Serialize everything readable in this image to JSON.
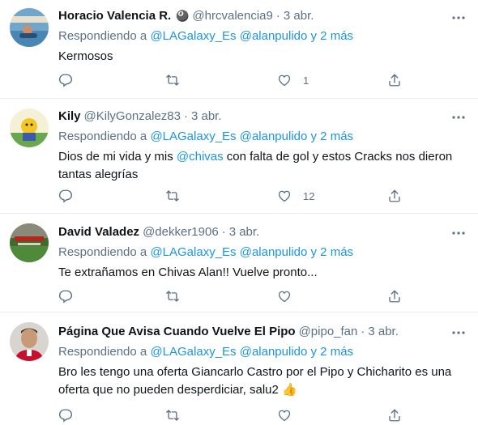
{
  "reply_prefix": "Respondiendo a",
  "tweets": [
    {
      "name": "Horacio Valencia R.",
      "badge": "🎱",
      "handle": "@hrcvalencia9",
      "dot": "·",
      "date": "3 abr.",
      "mention1": "@LAGalaxy_Es",
      "mention2": "@alanpulido",
      "and_more": "y 2 más",
      "text": "Kermosos",
      "likes": "1"
    },
    {
      "name": "Kily",
      "handle": "@KilyGonzalez83",
      "dot": "·",
      "date": "3 abr.",
      "mention1": "@LAGalaxy_Es",
      "mention2": "@alanpulido",
      "and_more": "y 2 más",
      "text_before": "Dios de mi vida y mis ",
      "text_link": "@chivas",
      "text_after": " con falta de gol y estos Cracks nos dieron tantas alegrías",
      "likes": "12"
    },
    {
      "name": "David Valadez",
      "handle": "@dekker1906",
      "dot": "·",
      "date": "3 abr.",
      "mention1": "@LAGalaxy_Es",
      "mention2": "@alanpulido",
      "and_more": "y 2 más",
      "text": "Te extrañamos en Chivas Alan!! Vuelve pronto...",
      "likes": ""
    },
    {
      "name": "Página Que Avisa Cuando Vuelve El Pipo",
      "handle": "@pipo_fan",
      "dot": "·",
      "date": "3 abr.",
      "mention1": "@LAGalaxy_Es",
      "mention2": "@alanpulido",
      "and_more": "y 2 más",
      "text": "Bro les tengo una oferta Giancarlo Castro por el Pipo y Chicharito es una oferta que no pueden desperdiciar, salu2 👍",
      "likes": ""
    }
  ],
  "colors": {
    "link": "#1b95e0",
    "secondary": "#5b7083",
    "primary": "#0f1419",
    "divider": "#e6ecf0",
    "icon": "#5b7083"
  },
  "icons": {
    "reply": "reply-icon",
    "retweet": "retweet-icon",
    "like": "heart-icon",
    "share": "share-icon",
    "more": "more-options-icon"
  }
}
